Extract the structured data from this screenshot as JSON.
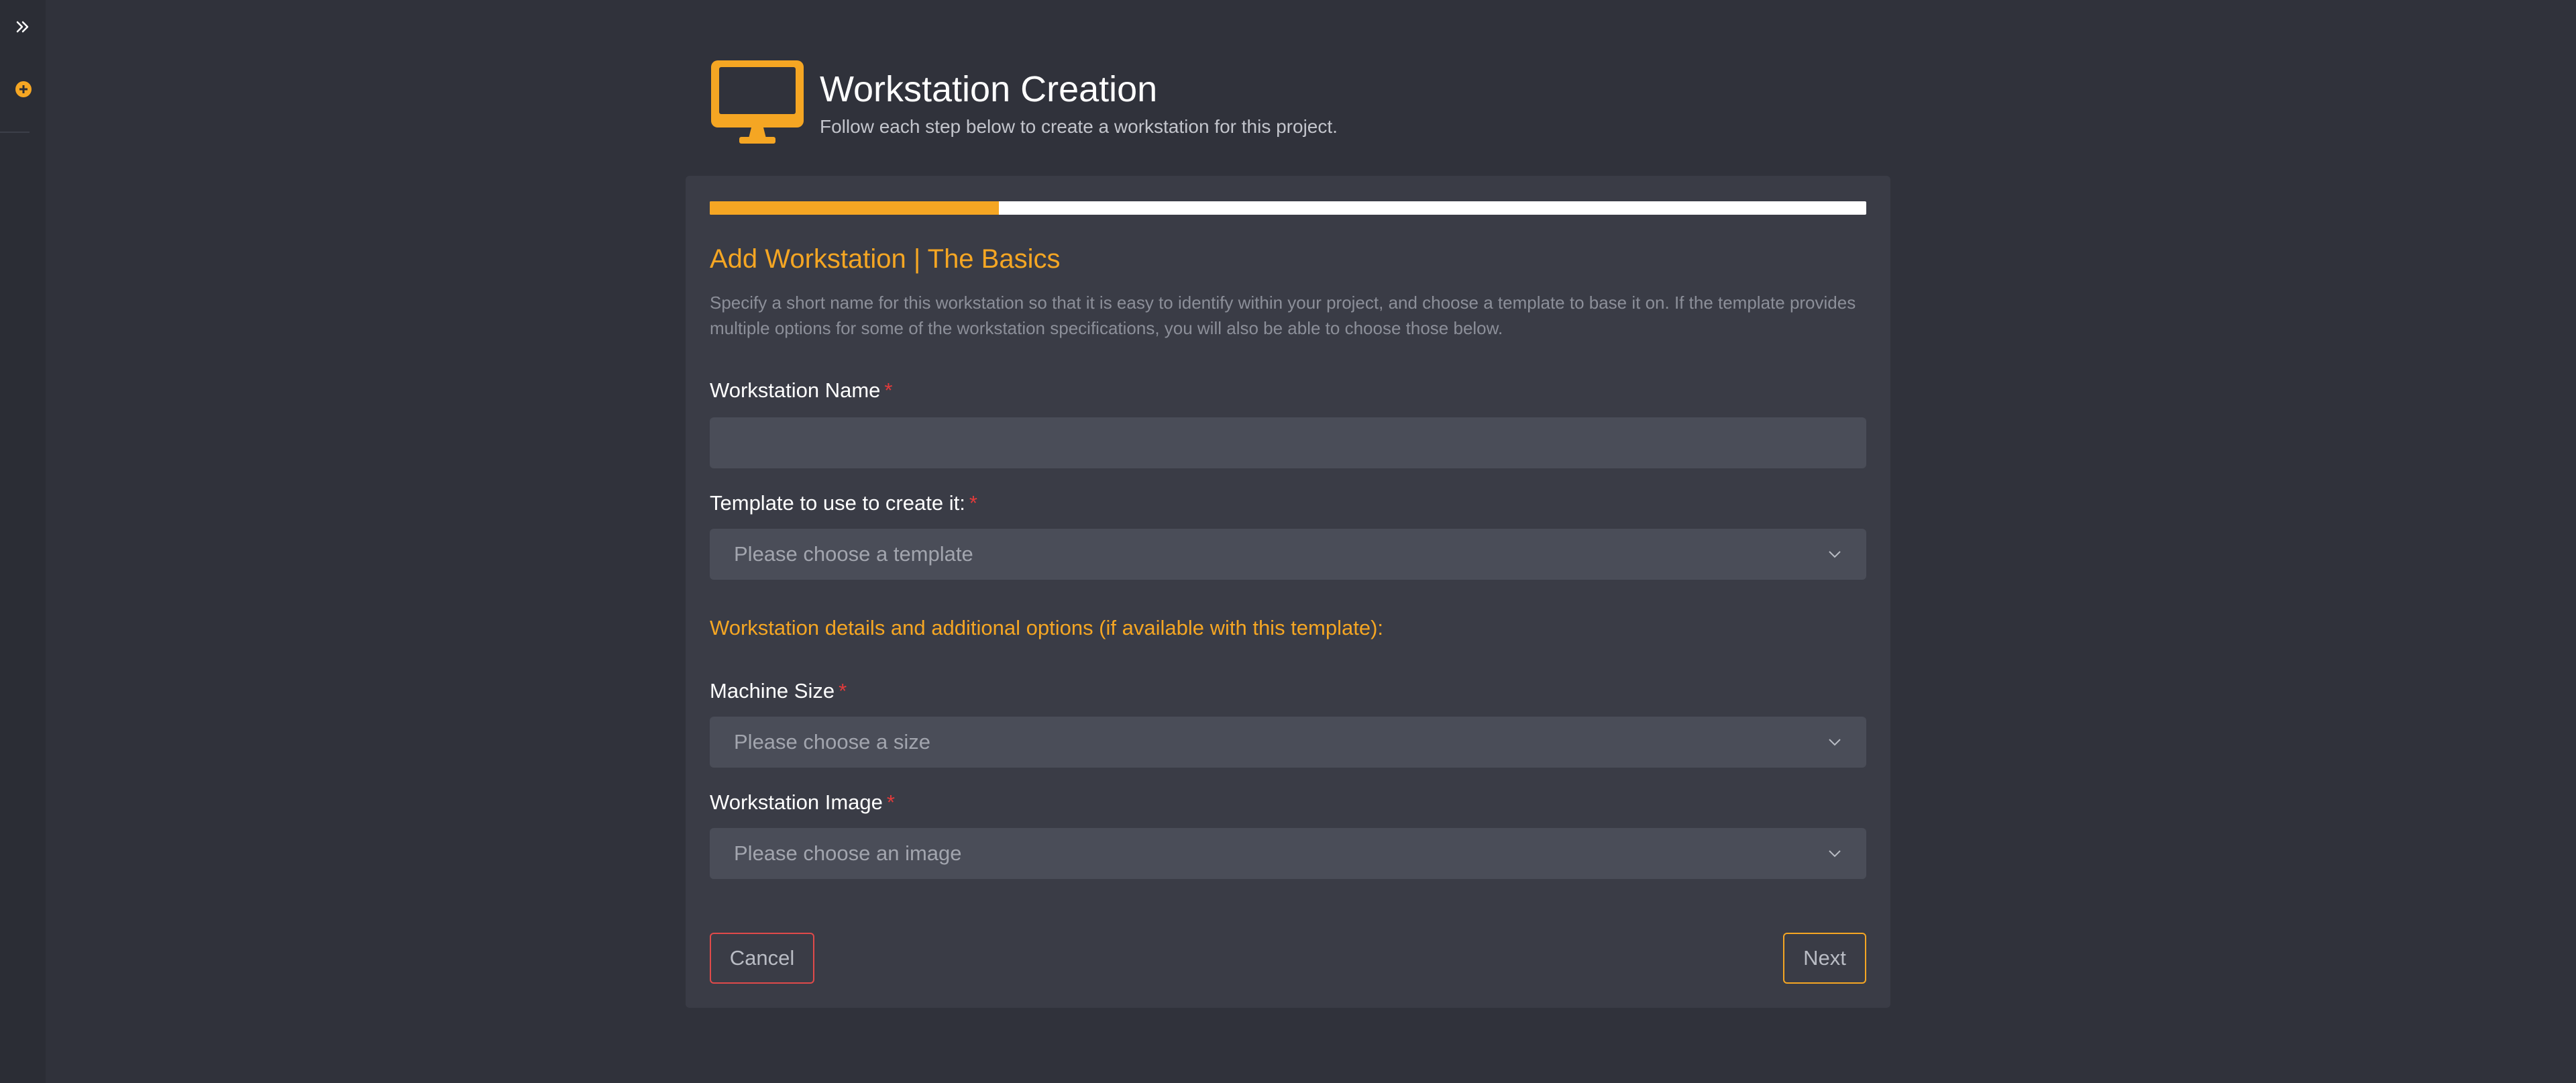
{
  "app": {
    "accent": "#f5a623",
    "background": "#30323b",
    "required_color": "#e23b3b"
  },
  "sidebar": {
    "expand_icon": "double-chevron-right-icon",
    "add_icon": "plus-circle-icon"
  },
  "header": {
    "icon": "monitor-icon",
    "title": "Workstation Creation",
    "subtitle": "Follow each step below to create a workstation for this project."
  },
  "wizard": {
    "progress_percent": 25,
    "section_title": "Add Workstation | The Basics",
    "description": "Specify a short name for this workstation so that it is easy to identify within your project, and choose a template to base it on. If the template provides multiple options for some of the workstation specifications, you will also be able to choose those below.",
    "fields": {
      "name": {
        "label": "Workstation Name",
        "required_mark": "*",
        "value": "",
        "placeholder": ""
      },
      "template": {
        "label": "Template to use to create it:",
        "required_mark": "*",
        "placeholder": "Please choose a template"
      },
      "details_heading": "Workstation details and additional options (if available with this template):",
      "machine_size": {
        "label": "Machine Size",
        "required_mark": "*",
        "placeholder": "Please choose a size"
      },
      "image": {
        "label": "Workstation Image",
        "required_mark": "*",
        "placeholder": "Please choose an image"
      }
    },
    "buttons": {
      "cancel": "Cancel",
      "next": "Next"
    }
  }
}
